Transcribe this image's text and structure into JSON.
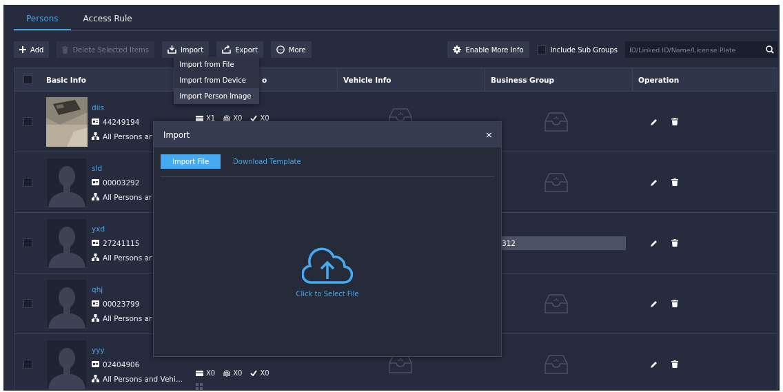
{
  "tabs": [
    {
      "label": "Persons",
      "selected": true
    },
    {
      "label": "Access Rule",
      "selected": false
    }
  ],
  "toolbar": {
    "left": [
      {
        "label": "Add",
        "disabled": false
      },
      {
        "label": "Delete Selected Items",
        "disabled": true
      },
      {
        "label": "Import",
        "disabled": false
      },
      {
        "label": "Export",
        "disabled": false
      },
      {
        "label": "More",
        "disabled": false
      }
    ],
    "enable_button": {
      "label": "Enable More Info"
    },
    "include_sub_groups": {
      "label": "Include Sub Groups",
      "checked": false
    },
    "search": {
      "placeholder": "ID/Linked ID/Name/License Plate"
    }
  },
  "import_menu": [
    {
      "label": "Import from File",
      "selected": false
    },
    {
      "label": "Import from Device",
      "selected": false
    },
    {
      "label": "Import Person Image",
      "selected": true
    }
  ],
  "table": {
    "columns": [
      {
        "label": "Basic Info"
      },
      {
        "label": "o"
      },
      {
        "label": "Vehicle Info"
      },
      {
        "label": "Business Group"
      },
      {
        "label": "Operation"
      }
    ],
    "header_checked": false,
    "rows": [
      {
        "checked": false,
        "name": "diis",
        "id": "44249194",
        "group": "All Persons ar",
        "counts": [
          "X1",
          "X0",
          "X0"
        ],
        "code_icon": false,
        "vehicle_icon": true,
        "business_group": null
      },
      {
        "checked": false,
        "kind": "silhouette",
        "name": "sld",
        "id": "00003292",
        "group": "All Persons ar",
        "counts": null,
        "code_icon": false,
        "vehicle_icon": false,
        "business_group": null
      },
      {
        "checked": false,
        "kind": "silhouette",
        "name": "yxd",
        "id": "27241115",
        "group": "All Persons ar",
        "counts": null,
        "code_icon": false,
        "vehicle_icon": false,
        "business_group": "312"
      },
      {
        "checked": false,
        "kind": "silhouette",
        "name": "qhj",
        "id": "00023799",
        "group": "All Persons ar",
        "counts": null,
        "code_icon": false,
        "vehicle_icon": false,
        "business_group": null
      },
      {
        "checked": false,
        "kind": "silhouette",
        "name": "yyy",
        "id": "02404906",
        "group": "All Persons and Vehi...",
        "counts": [
          "X0",
          "X0",
          "X0"
        ],
        "code_icon": true,
        "vehicle_icon": true,
        "business_group": null
      }
    ]
  },
  "dialog": {
    "title": "Import",
    "close": "×",
    "tabs": [
      {
        "label": "Import File",
        "selected": true
      },
      {
        "label": "Download Template",
        "selected": false
      }
    ],
    "upload_label": "Click to Select File"
  }
}
